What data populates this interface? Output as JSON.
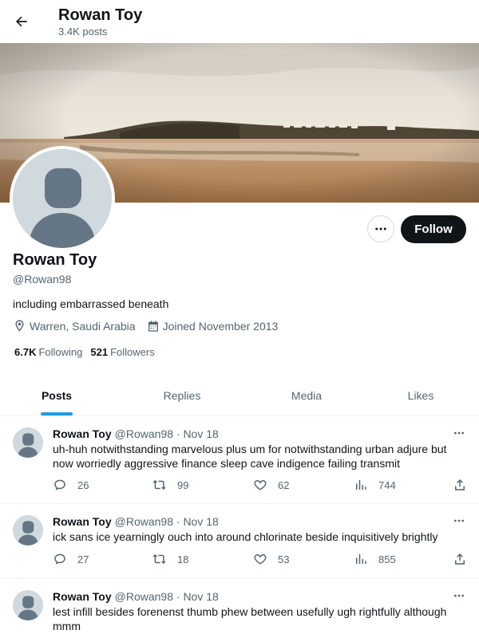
{
  "header": {
    "title": "Rowan Toy",
    "posts_count": "3.4K posts"
  },
  "profile": {
    "name": "Rowan Toy",
    "handle": "@Rowan98",
    "bio": "including embarrassed beneath",
    "location": "Warren, Saudi Arabia",
    "joined": "Joined November 2013",
    "following_count": "6.7K",
    "following_label": "Following",
    "followers_count": "521",
    "followers_label": "Followers",
    "follow_label": "Follow"
  },
  "tabs": [
    {
      "label": "Posts",
      "active": true
    },
    {
      "label": "Replies",
      "active": false
    },
    {
      "label": "Media",
      "active": false
    },
    {
      "label": "Likes",
      "active": false
    }
  ],
  "posts": [
    {
      "name": "Rowan Toy",
      "meta": "@Rowan98 · Nov 18",
      "text": "uh-huh notwithstanding marvelous plus um for notwithstanding urban adjure but now worriedly aggressive finance sleep cave indigence failing transmit",
      "replies": "26",
      "reposts": "99",
      "likes": "62",
      "views": "744"
    },
    {
      "name": "Rowan Toy",
      "meta": "@Rowan98 · Nov 18",
      "text": "ick sans ice yearningly ouch into around chlorinate beside inquisitively brightly",
      "replies": "27",
      "reposts": "18",
      "likes": "53",
      "views": "855"
    },
    {
      "name": "Rowan Toy",
      "meta": "@Rowan98 · Nov 18",
      "text": "lest infill besides forenenst thumb phew between usefully ugh rightfully although mmm",
      "replies": "",
      "reposts": "",
      "likes": "",
      "views": ""
    }
  ],
  "colors": {
    "accent": "#1d9bf0",
    "text": "#0f1419",
    "muted": "#536471",
    "follow_bg": "#0f1419"
  }
}
